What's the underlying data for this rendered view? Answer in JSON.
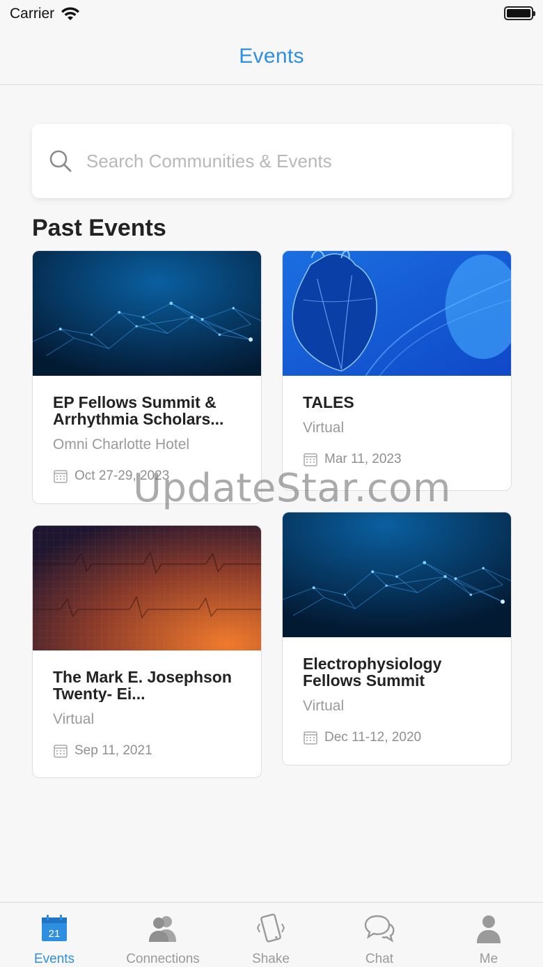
{
  "status_bar": {
    "carrier": "Carrier"
  },
  "nav": {
    "title": "Events"
  },
  "search": {
    "placeholder": "Search Communities & Events",
    "value": ""
  },
  "section": {
    "title": "Past Events"
  },
  "events": [
    {
      "title": "EP Fellows Summit & Arrhythmia Scholars...",
      "location": "Omni Charlotte Hotel",
      "date": "Oct 27-29, 2023",
      "image": "network-blue"
    },
    {
      "title": "TALES",
      "location": "Virtual",
      "date": "Mar 11, 2023",
      "image": "heart-blue"
    },
    {
      "title": "The Mark E. Josephson Twenty- Ei...",
      "location": "Virtual",
      "date": "Sep 11, 2021",
      "image": "ecg-orange"
    },
    {
      "title": "Electrophysiology Fellows Summit",
      "location": "Virtual",
      "date": "Dec 11-12, 2020",
      "image": "network-blue"
    }
  ],
  "watermark": "UpdateStar.com",
  "tabs": [
    {
      "label": "Events",
      "icon": "calendar-icon",
      "badge": "21",
      "active": true
    },
    {
      "label": "Connections",
      "icon": "people-icon",
      "active": false
    },
    {
      "label": "Shake",
      "icon": "phone-shake-icon",
      "active": false
    },
    {
      "label": "Chat",
      "icon": "chat-bubbles-icon",
      "active": false
    },
    {
      "label": "Me",
      "icon": "person-icon",
      "active": false
    }
  ],
  "colors": {
    "accent": "#2e8fe0",
    "background": "#f7f7f7",
    "muted_text": "#9a9a9a"
  }
}
